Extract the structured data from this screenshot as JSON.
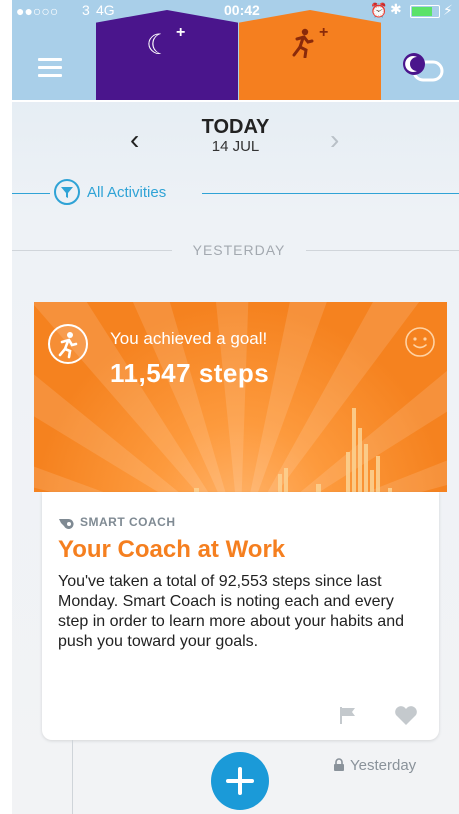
{
  "status_bar": {
    "signal": "●●○○○",
    "carrier": "3",
    "network": "4G",
    "time": "00:42"
  },
  "header": {
    "tabs": [
      {
        "name": "sleep",
        "icon": "moon-plus-icon"
      },
      {
        "name": "move",
        "icon": "runner-plus-icon"
      }
    ],
    "switch_icon": "moon-toggle-icon"
  },
  "date_nav": {
    "title": "TODAY",
    "subtitle": "14 JUL"
  },
  "filter": {
    "label": "All Activities"
  },
  "separator": {
    "label": "YESTERDAY"
  },
  "goal_card": {
    "message": "You achieved a goal!",
    "steps": "11,547 steps",
    "accent": "#f57f1f"
  },
  "coach_card": {
    "tag": "SMART COACH",
    "title": "Your Coach at Work",
    "body": "You've taken a total of 92,553 steps since last Monday. Smart Coach is noting each and every step in order to learn more about your habits and push you toward your goals."
  },
  "footer": {
    "timestamp": "Yesterday"
  },
  "colors": {
    "primary_blue": "#1b9ad8",
    "sleep_purple": "#4a158c",
    "move_orange": "#f57f1f"
  }
}
